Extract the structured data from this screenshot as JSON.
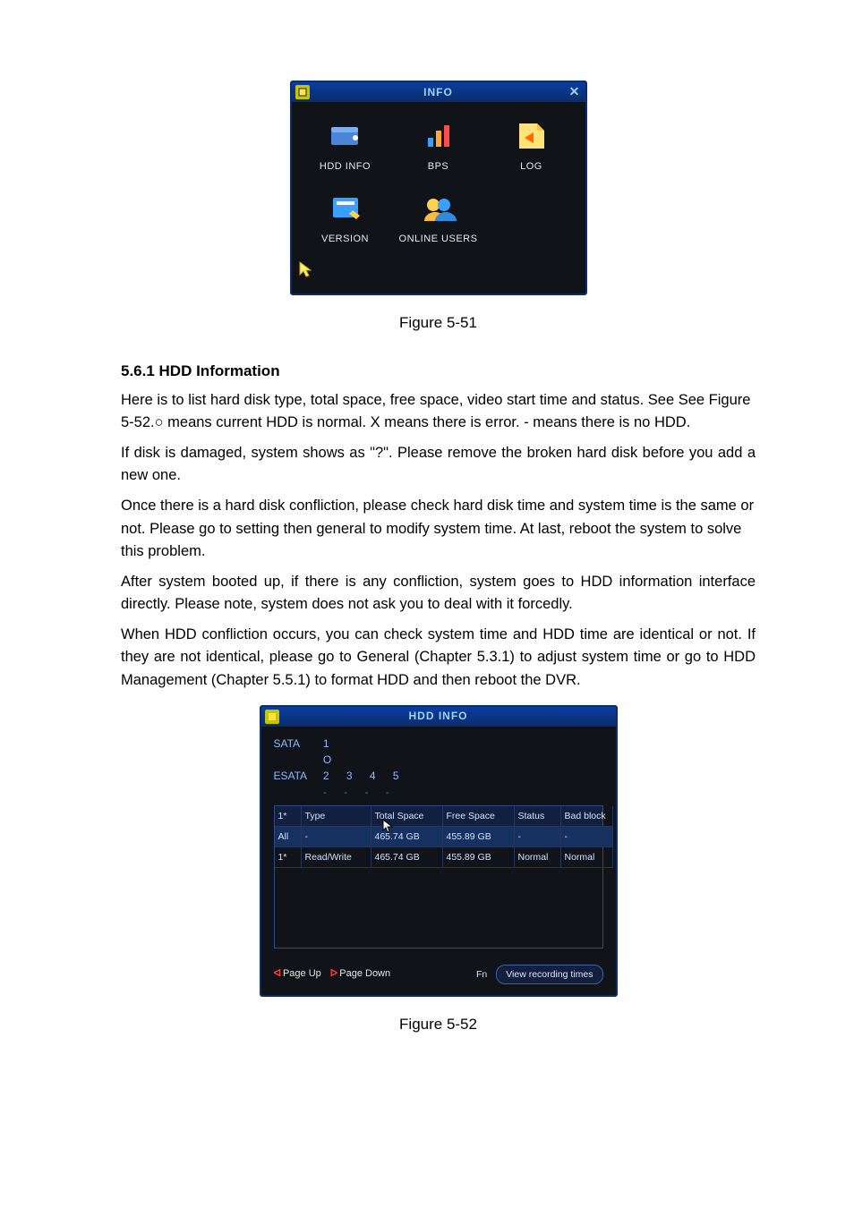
{
  "fig1": {
    "title": "INFO",
    "items": [
      {
        "label": "HDD INFO",
        "name": "hdd-info"
      },
      {
        "label": "BPS",
        "name": "bps"
      },
      {
        "label": "LOG",
        "name": "log"
      },
      {
        "label": "VERSION",
        "name": "version"
      },
      {
        "label": "ONLINE USERS",
        "name": "online-users"
      }
    ],
    "caption": "Figure 5-51"
  },
  "section": {
    "heading": "5.6.1  HDD Information",
    "p1": "Here is to list hard disk type, total space, free space, video start time and status. See  See Figure 5-52.○ means current HDD is normal. X means there is error. - means there is no HDD.",
    "p2": "If disk is damaged, system shows as \"?\". Please remove the broken hard disk before you add a new one.",
    "p3": "Once there is a hard disk confliction, please check hard disk time and system time is the same or not. Please go to setting then general to modify system time.    At last, reboot the system to solve this problem.",
    "p4": "After system booted up, if there is any confliction, system goes to HDD information interface directly. Please note, system does not ask you to deal with it forcedly.",
    "p5": "When HDD confliction occurs, you can check system time and HDD time are identical or not. If they are not identical, please go to General (Chapter 5.3.1) to adjust system time or go to HDD Management (Chapter 5.5.1) to format HDD and then reboot the DVR."
  },
  "fig2": {
    "title": "HDD INFO",
    "sata_label": "SATA",
    "sata_nums": "1",
    "sata_status": "O",
    "esata_label": "ESATA",
    "esata_nums": "2  3  4  5",
    "esata_status": "-  -  -  -",
    "headers": [
      "1*",
      "Type",
      "Total Space",
      "Free Space",
      "Status",
      "Bad block"
    ],
    "rows": [
      [
        "All",
        "-",
        "465.74 GB",
        "455.89 GB",
        "-",
        "-"
      ],
      [
        "1*",
        "Read/Write",
        "465.74 GB",
        "455.89 GB",
        "Normal",
        "Normal"
      ]
    ],
    "page_up": "Page Up",
    "page_down": "Page Down",
    "fn": "Fn",
    "view_btn": "View recording times",
    "caption": "Figure 5-52"
  }
}
